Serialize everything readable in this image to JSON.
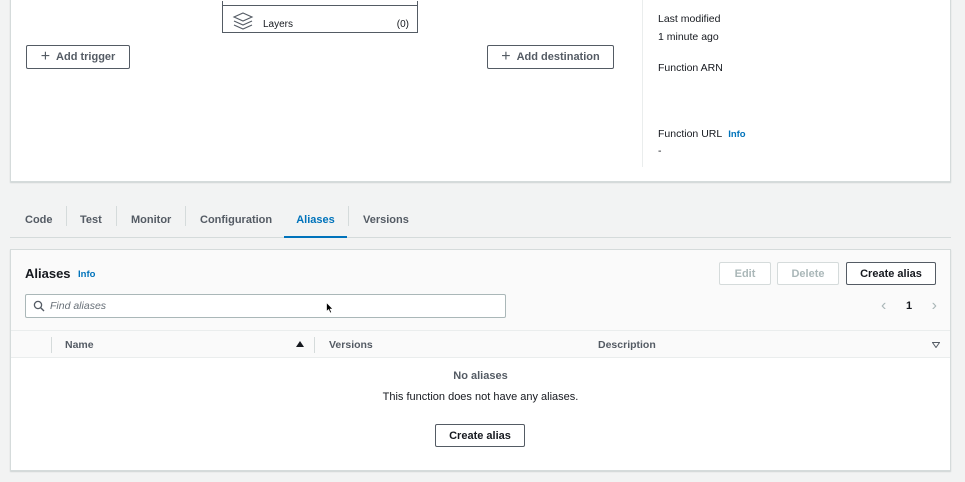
{
  "overview": {
    "layers_label": "Layers",
    "layers_count": "(0)",
    "add_trigger_label": "Add trigger",
    "add_destination_label": "Add destination",
    "last_modified_label": "Last modified",
    "last_modified_value": "1 minute ago",
    "function_arn_label": "Function ARN",
    "function_url_label": "Function URL",
    "function_url_info": "Info",
    "function_url_value": "-"
  },
  "tabs": [
    {
      "label": "Code"
    },
    {
      "label": "Test"
    },
    {
      "label": "Monitor"
    },
    {
      "label": "Configuration"
    },
    {
      "label": "Aliases",
      "active": true
    },
    {
      "label": "Versions"
    }
  ],
  "aliases": {
    "title": "Aliases",
    "info": "Info",
    "edit_label": "Edit",
    "delete_label": "Delete",
    "create_label": "Create alias",
    "search_placeholder": "Find aliases",
    "page": "1",
    "columns": [
      "Name",
      "Versions",
      "Description"
    ],
    "empty_title": "No aliases",
    "empty_text": "This function does not have any aliases.",
    "empty_create_label": "Create alias"
  },
  "colors": {
    "accent": "#0073bb",
    "border": "#d5dbdb",
    "text": "#16191f",
    "muted": "#545b64"
  }
}
